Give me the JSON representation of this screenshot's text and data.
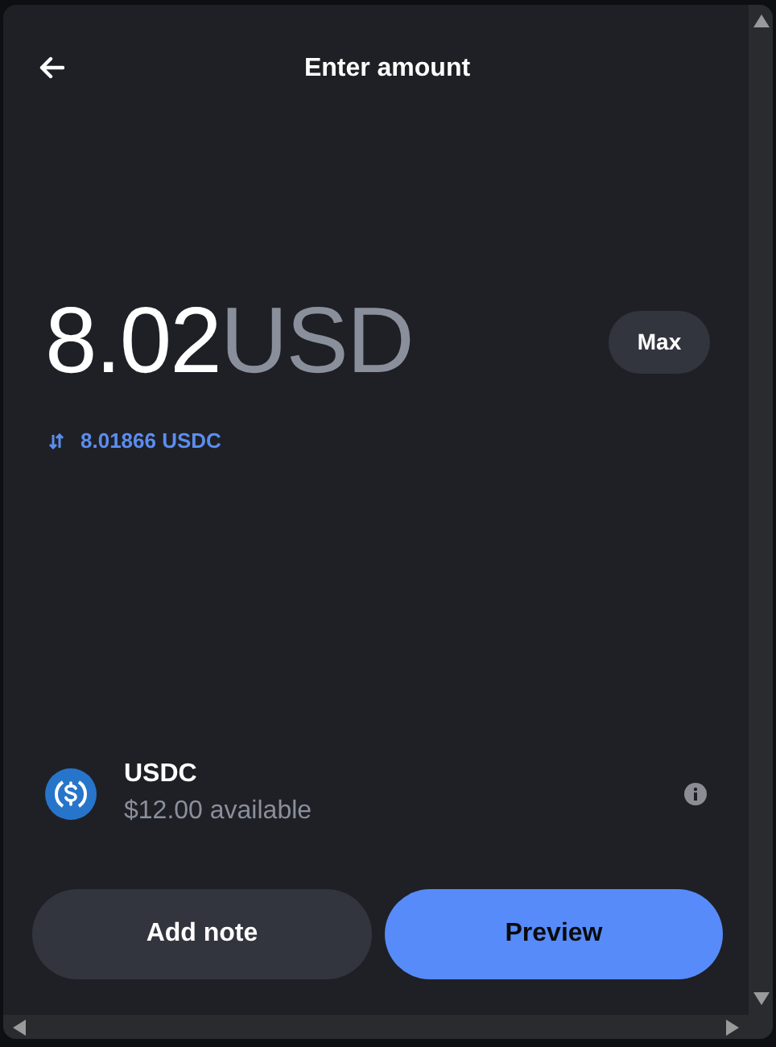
{
  "header": {
    "title": "Enter amount"
  },
  "amount": {
    "value": "8.02",
    "currency": "USD",
    "max_button": "Max"
  },
  "conversion": "8.01866 USDC",
  "asset": {
    "name": "USDC",
    "balance": "$12.00 available"
  },
  "buttons": [
    {
      "label": "Add note",
      "kind": "secondary"
    },
    {
      "label": "Preview",
      "kind": "primary"
    }
  ]
}
